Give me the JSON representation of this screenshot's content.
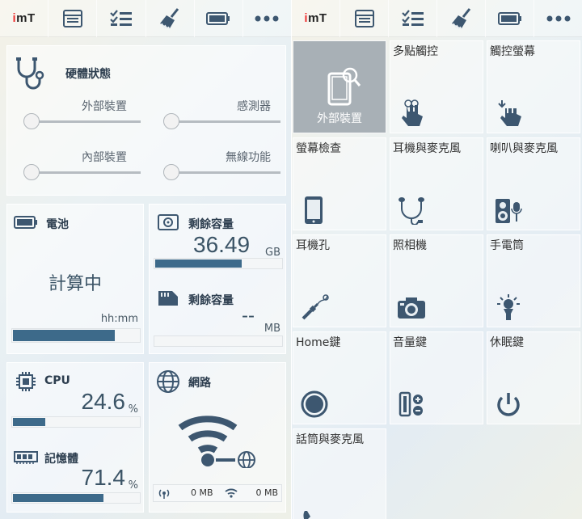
{
  "topbar": {
    "logo_i": "i",
    "logo_rest": "mT"
  },
  "hardware": {
    "title": "硬體狀態",
    "items": [
      {
        "label": "外部裝置",
        "value": 0
      },
      {
        "label": "感測器",
        "value": 0
      },
      {
        "label": "內部裝置",
        "value": 0
      },
      {
        "label": "無線功能",
        "value": 0
      }
    ]
  },
  "battery": {
    "title": "電池",
    "status": "計算中",
    "unit": "hh:mm",
    "level": 0.8
  },
  "storage": {
    "internal": {
      "title": "剩餘容量",
      "value": "36.49",
      "unit": "GB",
      "level": 0.68
    },
    "external": {
      "title": "剩餘容量",
      "value": "--",
      "unit": "MB",
      "level": 0
    }
  },
  "cpu": {
    "title": "CPU",
    "value": "24.6",
    "unit": "%",
    "level": 0.25
  },
  "memory": {
    "title": "記憶體",
    "value": "71.4",
    "unit": "%",
    "level": 0.71
  },
  "network": {
    "title": "網路",
    "mobile": "0 MB",
    "wifi": "0 MB"
  },
  "tests": [
    {
      "label": "外部裝置",
      "icon": "phone-search-icon"
    },
    {
      "label": "多點觸控",
      "icon": "multi-touch-icon"
    },
    {
      "label": "觸控螢幕",
      "icon": "touch-screen-icon"
    },
    {
      "label": "螢幕檢查",
      "icon": "phone-screen-icon"
    },
    {
      "label": "耳機與麥克風",
      "icon": "headset-icon"
    },
    {
      "label": "喇叭與麥克風",
      "icon": "speaker-mic-icon"
    },
    {
      "label": "耳機孔",
      "icon": "audio-jack-icon"
    },
    {
      "label": "照相機",
      "icon": "camera-icon"
    },
    {
      "label": "手電筒",
      "icon": "flashlight-icon"
    },
    {
      "label": "Home鍵",
      "icon": "home-button-icon"
    },
    {
      "label": "音量鍵",
      "icon": "volume-keys-icon"
    },
    {
      "label": "休眠鍵",
      "icon": "power-icon"
    },
    {
      "label": "話筒與麥克風",
      "icon": "phone-handset-icon"
    }
  ],
  "colors": {
    "accent": "#3d6a8a",
    "selected": "#a8b0b6",
    "icon": "#3d5770"
  }
}
